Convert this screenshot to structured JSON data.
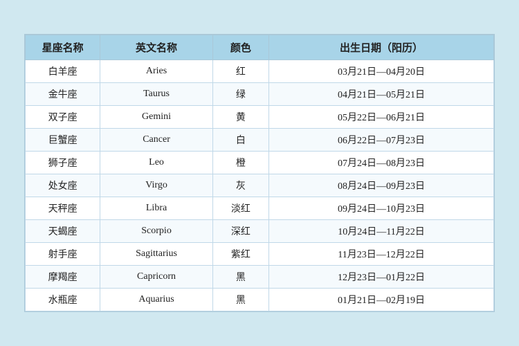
{
  "table": {
    "headers": [
      "星座名称",
      "英文名称",
      "颜色",
      "出生日期（阳历）"
    ],
    "rows": [
      {
        "zh": "白羊座",
        "en": "Aries",
        "color": "红",
        "date": "03月21日—04月20日"
      },
      {
        "zh": "金牛座",
        "en": "Taurus",
        "color": "绿",
        "date": "04月21日—05月21日"
      },
      {
        "zh": "双子座",
        "en": "Gemini",
        "color": "黄",
        "date": "05月22日—06月21日"
      },
      {
        "zh": "巨蟹座",
        "en": "Cancer",
        "color": "白",
        "date": "06月22日—07月23日"
      },
      {
        "zh": "狮子座",
        "en": "Leo",
        "color": "橙",
        "date": "07月24日—08月23日"
      },
      {
        "zh": "处女座",
        "en": "Virgo",
        "color": "灰",
        "date": "08月24日—09月23日"
      },
      {
        "zh": "天秤座",
        "en": "Libra",
        "color": "淡红",
        "date": "09月24日—10月23日"
      },
      {
        "zh": "天蝎座",
        "en": "Scorpio",
        "color": "深红",
        "date": "10月24日—11月22日"
      },
      {
        "zh": "射手座",
        "en": "Sagittarius",
        "color": "紫红",
        "date": "11月23日—12月22日"
      },
      {
        "zh": "摩羯座",
        "en": "Capricorn",
        "color": "黑",
        "date": "12月23日—01月22日"
      },
      {
        "zh": "水瓶座",
        "en": "Aquarius",
        "color": "黑",
        "date": "01月21日—02月19日"
      }
    ]
  }
}
